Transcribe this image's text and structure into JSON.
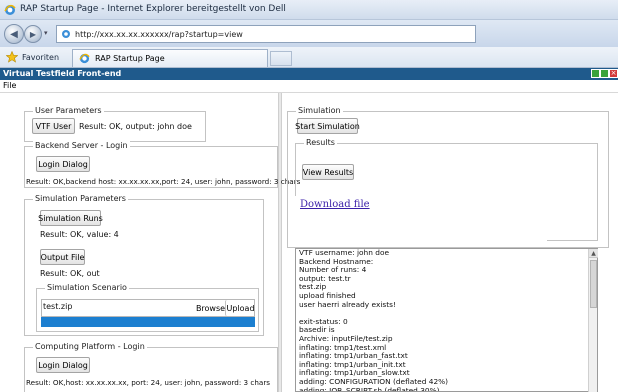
{
  "browser": {
    "title": "RAP Startup Page - Internet Explorer bereitgestellt von Dell",
    "url": "http://xxx.xx.xx.xxxxxx/rap?startup=view",
    "favorites_label": "Favoriten",
    "tab_label": "RAP Startup Page"
  },
  "app": {
    "title": "Virtual Testfield Front-end",
    "menu": [
      "File"
    ]
  },
  "left": {
    "user_parameters": {
      "legend": "User Parameters",
      "button": "VTF User",
      "result": "Result: OK, output: john doe"
    },
    "backend_login": {
      "legend": "Backend Server - Login",
      "button": "Login Dialog",
      "result": "Result: OK,backend host: xx.xx.xx.xx,port: 24, user: john, password: 3 chars"
    },
    "simulation_parameters": {
      "legend": "Simulation Parameters",
      "runs_button": "Simulation Runs",
      "runs_result": "Result: OK, value: 4",
      "output_button": "Output File",
      "output_result": "Result: OK, out",
      "scenario": {
        "legend": "Simulation Scenario",
        "file_value": "test.zip",
        "browse_label": "Browse",
        "upload_label": "Upload",
        "progress": 1.0
      }
    },
    "computing_login": {
      "legend": "Computing Platform - Login",
      "button": "Login Dialog",
      "result": "Result: OK,host: xx.xx.xx.xx, port: 24, user: john, password: 3 chars"
    }
  },
  "right": {
    "simulation": {
      "legend": "Simulation",
      "start_button": "Start Simulation"
    },
    "results": {
      "legend": "Results",
      "view_button": "View Results",
      "download_link": "Download file"
    },
    "log_lines": [
      "VTF username: john doe",
      "Backend Hostname:",
      "Number of runs: 4",
      "output: test.tr",
      "test.zip",
      "upload finished",
      "user haerri already exists!",
      "",
      "exit-status: 0",
      "basedir is",
      "Archive:  inputFile/test.zip",
      "  inflating: tmp1/test.xml",
      "  inflating: tmp1/urban_fast.txt",
      "  inflating: tmp1/urban_init.txt",
      "  inflating: tmp1/urban_slow.txt",
      "  adding: CONFIGURATION (deflated 42%)",
      "  adding: JOB_SCRIPT.sh (deflated 30%)"
    ]
  },
  "colors": {
    "app_titlebar": "#1f5a8c",
    "progress": "#1c7fd0",
    "link": "#3a1fa8"
  }
}
